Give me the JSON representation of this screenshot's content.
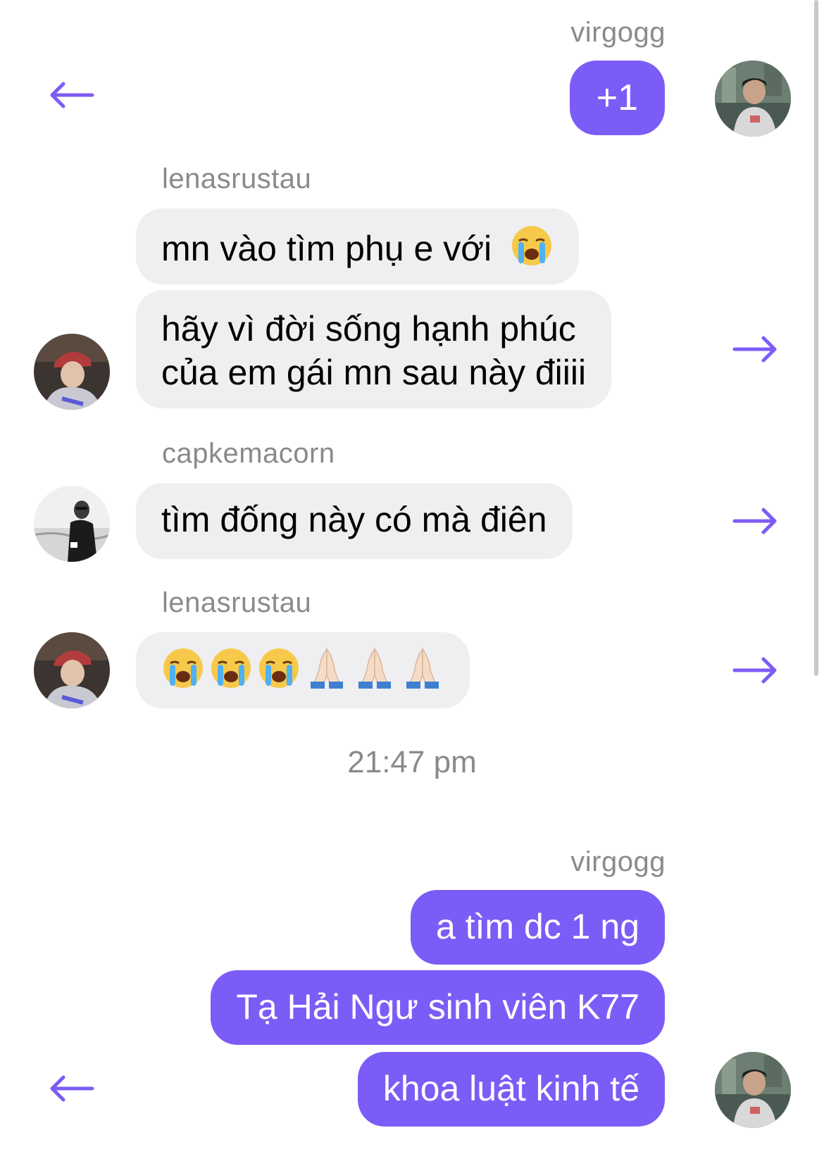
{
  "theme": {
    "accent": "#7c5cf6",
    "incoming_bubble": "#efeff1",
    "muted_text": "#8a8a8e"
  },
  "messages": {
    "group1": {
      "sender": "virgogg",
      "bubble1": "+1"
    },
    "group2": {
      "sender": "lenasrustau",
      "bubble1": "mn vào tìm phụ e với",
      "bubble2_line1": "hãy vì đời sống hạnh phúc",
      "bubble2_line2": "của em gái mn sau này điiii"
    },
    "group3": {
      "sender": "capkemacorn",
      "bubble1": "tìm đống này có mà điên"
    },
    "group4": {
      "sender": "lenasrustau",
      "emojis": [
        "loudly-crying-face",
        "loudly-crying-face",
        "loudly-crying-face",
        "folded-hands",
        "folded-hands",
        "folded-hands"
      ]
    },
    "timestamp": "21:47 pm",
    "group5": {
      "sender": "virgogg",
      "bubble1": "a tìm dc 1 ng",
      "bubble2": "Tạ Hải Ngư sinh viên K77",
      "bubble3": "khoa luật kinh tế"
    }
  },
  "icons": {
    "reply_left": "arrow-left-icon",
    "forward_right": "arrow-right-icon"
  }
}
